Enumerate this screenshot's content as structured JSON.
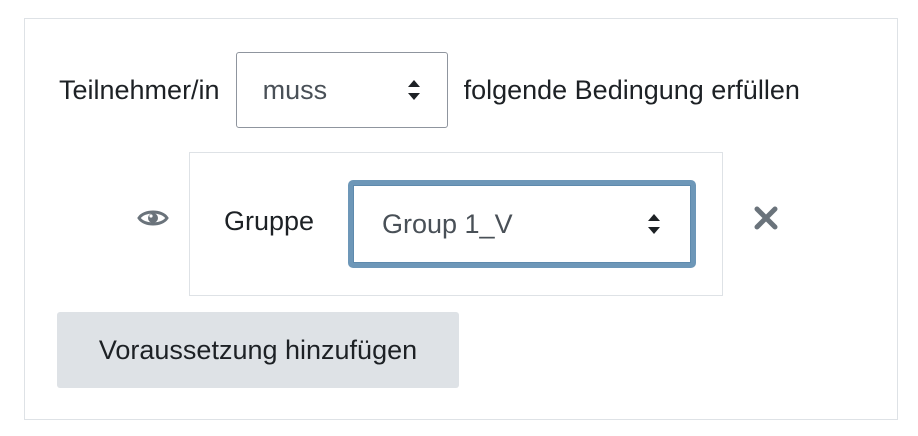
{
  "restriction": {
    "prefix_label": "Teilnehmer/in",
    "requirement_select": {
      "value": "muss",
      "icon": "sort-arrows-icon"
    },
    "suffix_label": "folgende Bedingung erfüllen"
  },
  "condition": {
    "visibility_icon": "eye-icon",
    "type_label": "Gruppe",
    "group_select": {
      "value": "Group 1_V",
      "icon": "sort-arrows-icon"
    },
    "delete_icon": "close-icon"
  },
  "add_button_label": "Voraussetzung hinzufügen",
  "colors": {
    "border": "#dee2e6",
    "focus_border": "#6d97b8",
    "button_bg": "#dee2e6",
    "icon": "#6a737b",
    "text": "#1d2125"
  }
}
